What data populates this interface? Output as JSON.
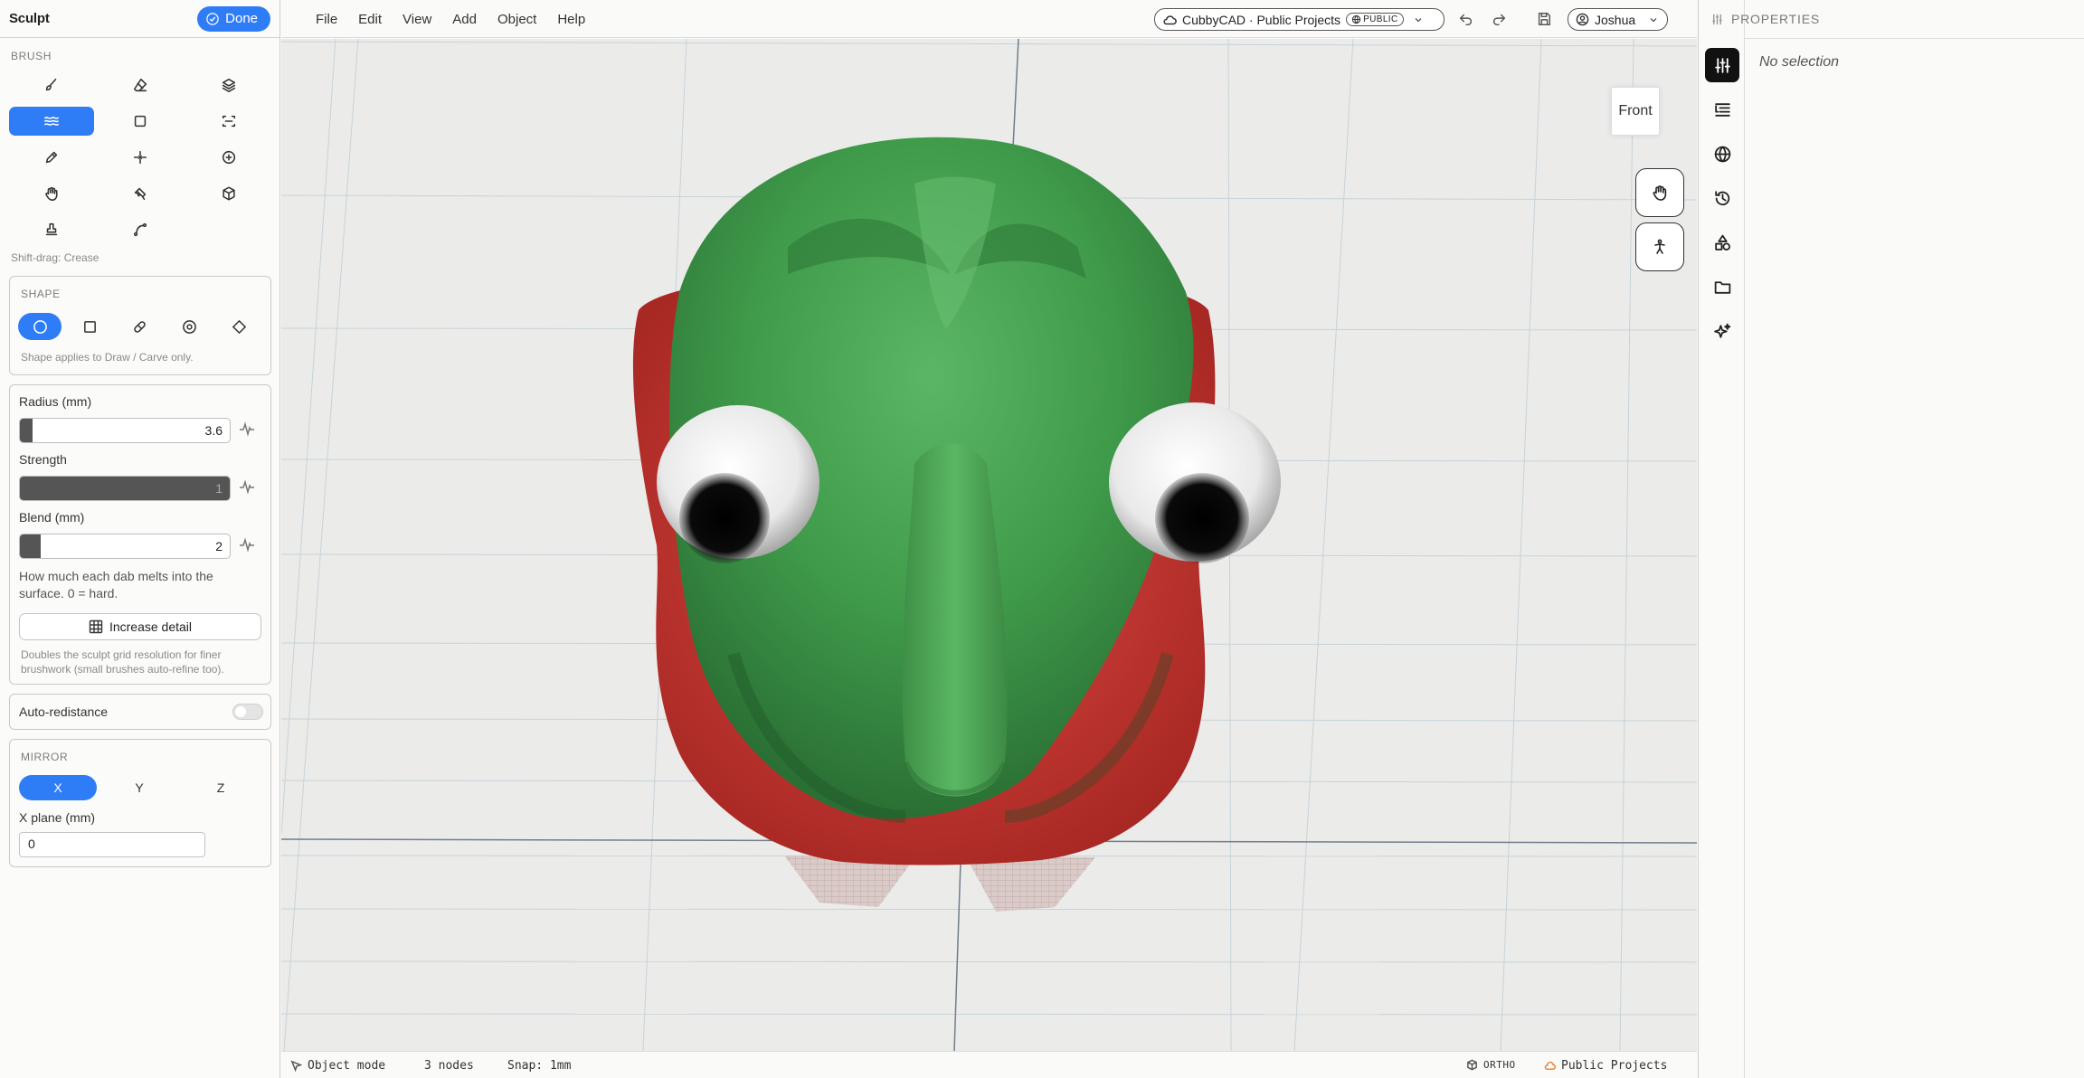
{
  "left_panel": {
    "title": "Sculpt",
    "done_label": "Done",
    "brush_label": "BRUSH",
    "brushes": [
      {
        "icon": "brush-icon",
        "active": false
      },
      {
        "icon": "eraser-icon",
        "active": false
      },
      {
        "icon": "layers-icon",
        "active": false
      },
      {
        "icon": "smooth-waves-icon",
        "active": true
      },
      {
        "icon": "square-icon",
        "active": false
      },
      {
        "icon": "flatten-icon",
        "active": false
      },
      {
        "icon": "pencil-icon",
        "active": false
      },
      {
        "icon": "pinch-icon",
        "active": false
      },
      {
        "icon": "inflate-plus-icon",
        "active": false
      },
      {
        "icon": "grab-hand-icon",
        "active": false
      },
      {
        "icon": "paint-brush-icon",
        "active": false
      },
      {
        "icon": "cube-icon",
        "active": false
      },
      {
        "icon": "stamp-icon",
        "active": false
      },
      {
        "icon": "curve-icon",
        "active": false
      }
    ],
    "brush_hint": "Shift-drag: Crease",
    "shape": {
      "label": "SHAPE",
      "options": [
        {
          "icon": "circle-icon",
          "active": true
        },
        {
          "icon": "square-icon",
          "active": false
        },
        {
          "icon": "capsule-icon",
          "active": false
        },
        {
          "icon": "ring-icon",
          "active": false
        },
        {
          "icon": "diamond-icon",
          "active": false
        }
      ],
      "hint": "Shape applies to Draw / Carve only."
    },
    "radius": {
      "label": "Radius (mm)",
      "value": "3.6",
      "fill": 0.06
    },
    "strength": {
      "label": "Strength",
      "value": "1",
      "fill": 1.0
    },
    "blend": {
      "label": "Blend (mm)",
      "value": "2",
      "fill": 0.1
    },
    "blend_hint": "How much each dab melts into the surface. 0 = hard.",
    "increase_detail_label": "Increase detail",
    "increase_detail_hint": "Doubles the sculpt grid resolution for finer brushwork (small brushes auto-refine too).",
    "auto_redistance": {
      "label": "Auto-redistance",
      "on": false
    },
    "mirror": {
      "label": "MIRROR",
      "axes": [
        {
          "label": "X",
          "active": true
        },
        {
          "label": "Y",
          "active": false
        },
        {
          "label": "Z",
          "active": false
        }
      ],
      "plane_label": "X plane (mm)",
      "plane_value": "0"
    }
  },
  "topbar": {
    "menu": [
      "File",
      "Edit",
      "View",
      "Add",
      "Object",
      "Help"
    ],
    "project": "CubbyCAD · Public Projects",
    "badge": "PUBLIC",
    "user": "Joshua"
  },
  "viewport": {
    "viewcube_label": "Front"
  },
  "status": {
    "mode": "Object mode",
    "nodes": "3 nodes",
    "snap": "Snap: 1mm",
    "projection": "ORTHO",
    "project": "Public Projects"
  },
  "right": {
    "properties_title": "PROPERTIES",
    "no_selection": "No selection"
  },
  "colors": {
    "accent": "#2f7df6",
    "head_green": "#3f9a4a",
    "head_red": "#d03b36",
    "eye_white": "#f2f2f2"
  }
}
